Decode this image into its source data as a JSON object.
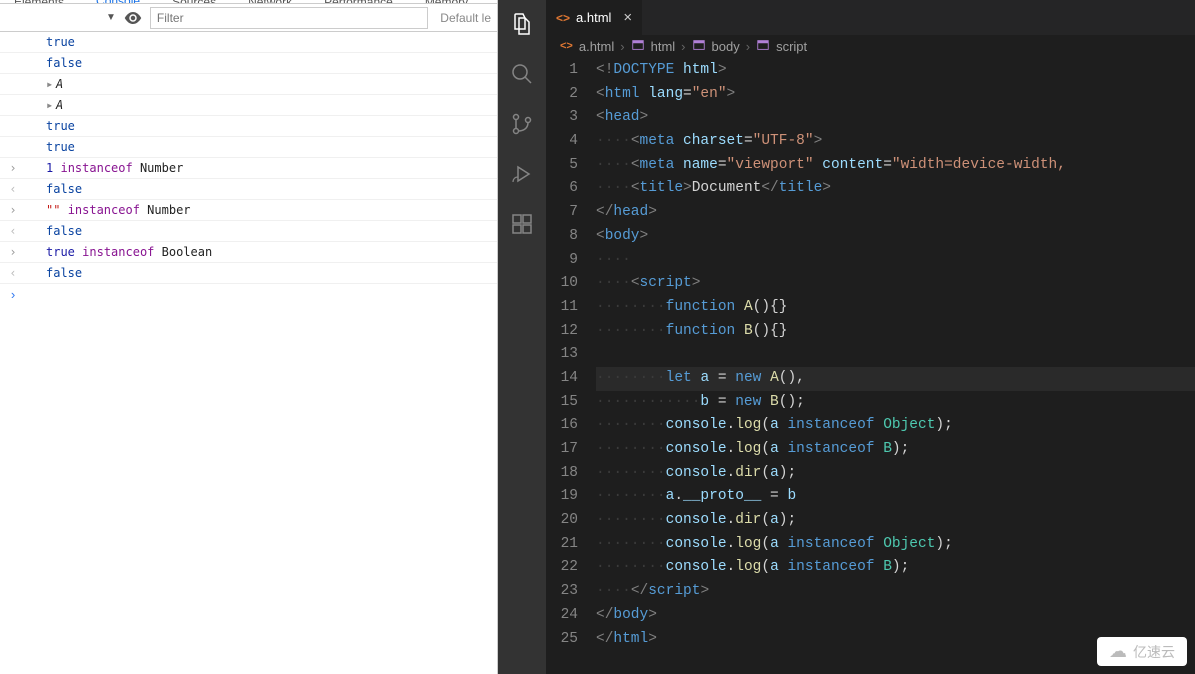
{
  "devtools": {
    "tabs": [
      "Elements",
      "Console",
      "Sources",
      "Network",
      "Performance",
      "Memory"
    ],
    "active_tab": "Console",
    "filter_placeholder": "Filter",
    "level_label": "Default le",
    "rows": [
      {
        "type": "log",
        "tokens": [
          {
            "cls": "tok-true",
            "text": "true"
          }
        ]
      },
      {
        "type": "log",
        "tokens": [
          {
            "cls": "tok-false",
            "text": "false"
          }
        ]
      },
      {
        "type": "log",
        "expandable": true,
        "tokens": [
          {
            "cls": "tok-expand",
            "text": "▸"
          },
          {
            "cls": "tok-objname",
            "text": "A"
          }
        ]
      },
      {
        "type": "log",
        "expandable": true,
        "tokens": [
          {
            "cls": "tok-expand",
            "text": "▸"
          },
          {
            "cls": "tok-objname",
            "text": "A"
          }
        ]
      },
      {
        "type": "log",
        "tokens": [
          {
            "cls": "tok-true",
            "text": "true"
          }
        ]
      },
      {
        "type": "log",
        "tokens": [
          {
            "cls": "tok-true",
            "text": "true"
          }
        ]
      },
      {
        "type": "in",
        "tokens": [
          {
            "cls": "tok-num",
            "text": "1"
          },
          {
            "cls": "",
            "text": " "
          },
          {
            "cls": "tok-key",
            "text": "instanceof"
          },
          {
            "cls": "",
            "text": " "
          },
          {
            "cls": "tok-obj",
            "text": "Number"
          }
        ]
      },
      {
        "type": "out",
        "tokens": [
          {
            "cls": "tok-false",
            "text": "false"
          }
        ]
      },
      {
        "type": "in",
        "tokens": [
          {
            "cls": "tok-str",
            "text": "\"\""
          },
          {
            "cls": "",
            "text": " "
          },
          {
            "cls": "tok-key",
            "text": "instanceof"
          },
          {
            "cls": "",
            "text": " "
          },
          {
            "cls": "tok-obj",
            "text": "Number"
          }
        ]
      },
      {
        "type": "out",
        "tokens": [
          {
            "cls": "tok-false",
            "text": "false"
          }
        ]
      },
      {
        "type": "in",
        "tokens": [
          {
            "cls": "tok-num",
            "text": "true"
          },
          {
            "cls": "",
            "text": " "
          },
          {
            "cls": "tok-key",
            "text": "instanceof"
          },
          {
            "cls": "",
            "text": " "
          },
          {
            "cls": "tok-obj",
            "text": "Boolean"
          }
        ]
      },
      {
        "type": "out",
        "tokens": [
          {
            "cls": "tok-false",
            "text": "false"
          }
        ]
      }
    ]
  },
  "vscode": {
    "tab_name": "a.html",
    "breadcrumb": [
      "a.html",
      "html",
      "body",
      "script"
    ],
    "code": [
      [
        {
          "c": "t-punc",
          "t": "<!"
        },
        {
          "c": "t-doctype",
          "t": "DOCTYPE"
        },
        {
          "c": "",
          "t": " "
        },
        {
          "c": "t-attr",
          "t": "html"
        },
        {
          "c": "t-punc",
          "t": ">"
        }
      ],
      [
        {
          "c": "t-punc",
          "t": "<"
        },
        {
          "c": "t-tag",
          "t": "html"
        },
        {
          "c": "",
          "t": " "
        },
        {
          "c": "t-attr",
          "t": "lang"
        },
        {
          "c": "t-op",
          "t": "="
        },
        {
          "c": "t-str",
          "t": "\"en\""
        },
        {
          "c": "t-punc",
          "t": ">"
        }
      ],
      [
        {
          "c": "t-punc",
          "t": "<"
        },
        {
          "c": "t-tag",
          "t": "head"
        },
        {
          "c": "t-punc",
          "t": ">"
        }
      ],
      [
        {
          "c": "ws",
          "t": "····"
        },
        {
          "c": "t-punc",
          "t": "<"
        },
        {
          "c": "t-tag",
          "t": "meta"
        },
        {
          "c": "",
          "t": " "
        },
        {
          "c": "t-attr",
          "t": "charset"
        },
        {
          "c": "t-op",
          "t": "="
        },
        {
          "c": "t-str",
          "t": "\"UTF-8\""
        },
        {
          "c": "t-punc",
          "t": ">"
        }
      ],
      [
        {
          "c": "ws",
          "t": "····"
        },
        {
          "c": "t-punc",
          "t": "<"
        },
        {
          "c": "t-tag",
          "t": "meta"
        },
        {
          "c": "",
          "t": " "
        },
        {
          "c": "t-attr",
          "t": "name"
        },
        {
          "c": "t-op",
          "t": "="
        },
        {
          "c": "t-str",
          "t": "\"viewport\""
        },
        {
          "c": "",
          "t": " "
        },
        {
          "c": "t-attr",
          "t": "content"
        },
        {
          "c": "t-op",
          "t": "="
        },
        {
          "c": "t-str",
          "t": "\"width=device-width,"
        }
      ],
      [
        {
          "c": "ws",
          "t": "····"
        },
        {
          "c": "t-punc",
          "t": "<"
        },
        {
          "c": "t-tag",
          "t": "title"
        },
        {
          "c": "t-punc",
          "t": ">"
        },
        {
          "c": "t-text",
          "t": "Document"
        },
        {
          "c": "t-punc",
          "t": "</"
        },
        {
          "c": "t-tag",
          "t": "title"
        },
        {
          "c": "t-punc",
          "t": ">"
        }
      ],
      [
        {
          "c": "t-punc",
          "t": "</"
        },
        {
          "c": "t-tag",
          "t": "head"
        },
        {
          "c": "t-punc",
          "t": ">"
        }
      ],
      [
        {
          "c": "t-punc",
          "t": "<"
        },
        {
          "c": "t-tag",
          "t": "body"
        },
        {
          "c": "t-punc",
          "t": ">"
        }
      ],
      [
        {
          "c": "ws",
          "t": "····"
        }
      ],
      [
        {
          "c": "ws",
          "t": "····"
        },
        {
          "c": "t-punc",
          "t": "<"
        },
        {
          "c": "t-tag",
          "t": "script"
        },
        {
          "c": "t-punc",
          "t": ">"
        }
      ],
      [
        {
          "c": "ws",
          "t": "········"
        },
        {
          "c": "t-new",
          "t": "function"
        },
        {
          "c": "",
          "t": " "
        },
        {
          "c": "t-func",
          "t": "A"
        },
        {
          "c": "t-text",
          "t": "(){}"
        }
      ],
      [
        {
          "c": "ws",
          "t": "········"
        },
        {
          "c": "t-new",
          "t": "function"
        },
        {
          "c": "",
          "t": " "
        },
        {
          "c": "t-func",
          "t": "B"
        },
        {
          "c": "t-text",
          "t": "(){}"
        }
      ],
      [
        {
          "c": "",
          "t": ""
        }
      ],
      [
        {
          "c": "ws",
          "t": "········"
        },
        {
          "c": "t-new",
          "t": "let"
        },
        {
          "c": "",
          "t": " "
        },
        {
          "c": "t-var",
          "t": "a"
        },
        {
          "c": "t-text",
          "t": " = "
        },
        {
          "c": "t-new",
          "t": "new"
        },
        {
          "c": "",
          "t": " "
        },
        {
          "c": "t-func",
          "t": "A"
        },
        {
          "c": "t-text",
          "t": "(),"
        }
      ],
      [
        {
          "c": "ws",
          "t": "············"
        },
        {
          "c": "t-var",
          "t": "b"
        },
        {
          "c": "t-text",
          "t": " = "
        },
        {
          "c": "t-new",
          "t": "new"
        },
        {
          "c": "",
          "t": " "
        },
        {
          "c": "t-func",
          "t": "B"
        },
        {
          "c": "t-text",
          "t": "();"
        }
      ],
      [
        {
          "c": "ws",
          "t": "········"
        },
        {
          "c": "t-var",
          "t": "console"
        },
        {
          "c": "t-text",
          "t": "."
        },
        {
          "c": "t-func",
          "t": "log"
        },
        {
          "c": "t-text",
          "t": "("
        },
        {
          "c": "t-var",
          "t": "a"
        },
        {
          "c": "",
          "t": " "
        },
        {
          "c": "t-new",
          "t": "instanceof"
        },
        {
          "c": "",
          "t": " "
        },
        {
          "c": "t-type",
          "t": "Object"
        },
        {
          "c": "t-text",
          "t": ");"
        }
      ],
      [
        {
          "c": "ws",
          "t": "········"
        },
        {
          "c": "t-var",
          "t": "console"
        },
        {
          "c": "t-text",
          "t": "."
        },
        {
          "c": "t-func",
          "t": "log"
        },
        {
          "c": "t-text",
          "t": "("
        },
        {
          "c": "t-var",
          "t": "a"
        },
        {
          "c": "",
          "t": " "
        },
        {
          "c": "t-new",
          "t": "instanceof"
        },
        {
          "c": "",
          "t": " "
        },
        {
          "c": "t-type",
          "t": "B"
        },
        {
          "c": "t-text",
          "t": ");"
        }
      ],
      [
        {
          "c": "ws",
          "t": "········"
        },
        {
          "c": "t-var",
          "t": "console"
        },
        {
          "c": "t-text",
          "t": "."
        },
        {
          "c": "t-func",
          "t": "dir"
        },
        {
          "c": "t-text",
          "t": "("
        },
        {
          "c": "t-var",
          "t": "a"
        },
        {
          "c": "t-text",
          "t": ");"
        }
      ],
      [
        {
          "c": "ws",
          "t": "········"
        },
        {
          "c": "t-var",
          "t": "a"
        },
        {
          "c": "t-text",
          "t": "."
        },
        {
          "c": "t-var",
          "t": "__proto__"
        },
        {
          "c": "t-text",
          "t": " = "
        },
        {
          "c": "t-var",
          "t": "b"
        }
      ],
      [
        {
          "c": "ws",
          "t": "········"
        },
        {
          "c": "t-var",
          "t": "console"
        },
        {
          "c": "t-text",
          "t": "."
        },
        {
          "c": "t-func",
          "t": "dir"
        },
        {
          "c": "t-text",
          "t": "("
        },
        {
          "c": "t-var",
          "t": "a"
        },
        {
          "c": "t-text",
          "t": ");"
        }
      ],
      [
        {
          "c": "ws",
          "t": "········"
        },
        {
          "c": "t-var",
          "t": "console"
        },
        {
          "c": "t-text",
          "t": "."
        },
        {
          "c": "t-func",
          "t": "log"
        },
        {
          "c": "t-text",
          "t": "("
        },
        {
          "c": "t-var",
          "t": "a"
        },
        {
          "c": "",
          "t": " "
        },
        {
          "c": "t-new",
          "t": "instanceof"
        },
        {
          "c": "",
          "t": " "
        },
        {
          "c": "t-type",
          "t": "Object"
        },
        {
          "c": "t-text",
          "t": ");"
        }
      ],
      [
        {
          "c": "ws",
          "t": "········"
        },
        {
          "c": "t-var",
          "t": "console"
        },
        {
          "c": "t-text",
          "t": "."
        },
        {
          "c": "t-func",
          "t": "log"
        },
        {
          "c": "t-text",
          "t": "("
        },
        {
          "c": "t-var",
          "t": "a"
        },
        {
          "c": "",
          "t": " "
        },
        {
          "c": "t-new",
          "t": "instanceof"
        },
        {
          "c": "",
          "t": " "
        },
        {
          "c": "t-type",
          "t": "B"
        },
        {
          "c": "t-text",
          "t": ");"
        }
      ],
      [
        {
          "c": "ws",
          "t": "····"
        },
        {
          "c": "t-punc",
          "t": "</"
        },
        {
          "c": "t-tag",
          "t": "script"
        },
        {
          "c": "t-punc",
          "t": ">"
        }
      ],
      [
        {
          "c": "t-punc",
          "t": "</"
        },
        {
          "c": "t-tag",
          "t": "body"
        },
        {
          "c": "t-punc",
          "t": ">"
        }
      ],
      [
        {
          "c": "t-punc",
          "t": "</"
        },
        {
          "c": "t-tag",
          "t": "html"
        },
        {
          "c": "t-punc",
          "t": ">"
        }
      ]
    ],
    "highlighted_line": 14
  },
  "watermark": "亿速云"
}
